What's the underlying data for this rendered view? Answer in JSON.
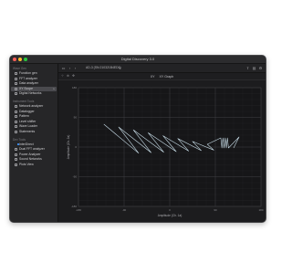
{
  "window": {
    "title": "Digital Discovery 3.0"
  },
  "toolbar": {
    "device": "AD-3 (SN:210321B4ED6)"
  },
  "tabs": [
    "XY",
    "XY Graph"
  ],
  "sidebar": {
    "sections": [
      {
        "title": "Wave Gen",
        "items": [
          {
            "label": "Function gen",
            "active": false
          },
          {
            "label": "FFT analyzer",
            "active": false
          },
          {
            "label": "Data analyzer",
            "active": false
          },
          {
            "label": "XY Scope",
            "active": true
          },
          {
            "label": "Digital Networks",
            "active": false
          }
        ]
      },
      {
        "title": "Instrument Tools",
        "items": [
          {
            "label": "Network analyzer",
            "active": false
          },
          {
            "label": "Datalogger",
            "active": false
          },
          {
            "label": "Pattern",
            "active": false
          },
          {
            "label": "Level shifter",
            "active": false
          },
          {
            "label": "Wave Loader",
            "active": false
          },
          {
            "label": "Statements",
            "active": false
          }
        ]
      },
      {
        "title": "Dev Tools",
        "items": [
          {
            "label": "InterDirect",
            "active": false,
            "checked": true
          },
          {
            "label": "Dual FFT analyzer",
            "active": false
          },
          {
            "label": "Power Analyzer",
            "active": false
          },
          {
            "label": "Sound Networks",
            "active": false
          },
          {
            "label": "Plots View",
            "active": false
          }
        ]
      }
    ]
  },
  "plot": {
    "xlabel": "Amplitude (Ch. 1a)",
    "ylabel": "Amplitude (Ch. 2a)",
    "xticks": [
      "-180",
      "-90",
      "0",
      "90",
      "180"
    ],
    "yticks": [
      "180",
      "90",
      "0",
      "-90",
      "-180"
    ],
    "trace_color": "#c8dde8"
  }
}
